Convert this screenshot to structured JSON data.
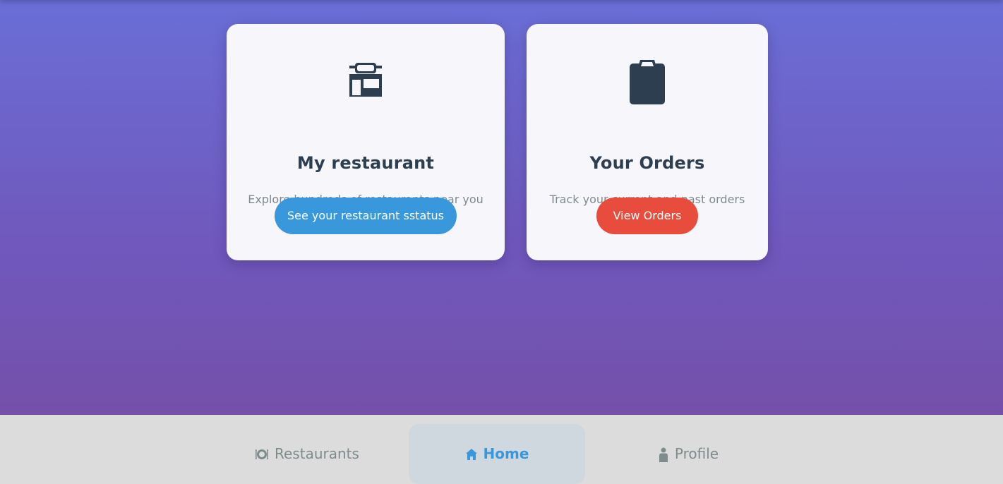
{
  "cards": [
    {
      "icon": "store-icon",
      "title": "My restaurant",
      "description": "Explore hundreds of restaurants near you",
      "button_label": "See your restaurant sstatus",
      "button_color": "#3898db"
    },
    {
      "icon": "clipboard-icon",
      "title": "Your Orders",
      "description": "Track your current and past orders",
      "button_label": "View Orders",
      "button_color": "#e74c3c"
    }
  ],
  "nav": {
    "items": [
      {
        "icon": "plate-utensils-icon",
        "label": "Restaurants",
        "active": false
      },
      {
        "icon": "home-icon",
        "label": "Home",
        "active": true
      },
      {
        "icon": "person-icon",
        "label": "Profile",
        "active": false
      }
    ]
  },
  "colors": {
    "background_gradient_top": "#6a6ed6",
    "background_gradient_bottom": "#7450aa",
    "card_bg": "#f6f6fb",
    "title": "#2c3e50",
    "muted": "#7f8c8d",
    "accent": "#3898db",
    "nav_bg": "#dcdcdc",
    "nav_active_bg": "#d0d8df"
  }
}
